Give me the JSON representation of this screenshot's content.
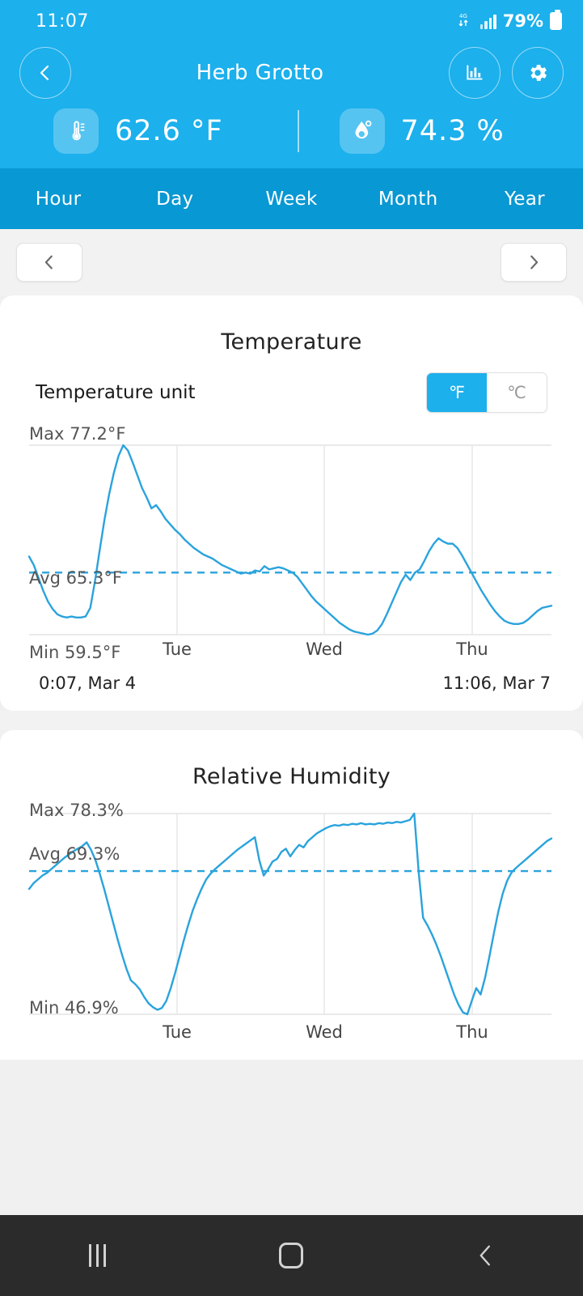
{
  "status_bar": {
    "time": "11:07",
    "network_icon": "4g-data-transfer-icon",
    "signal_icon": "signal-bars-icon",
    "battery_percent": "79%",
    "battery_icon": "battery-icon"
  },
  "header": {
    "back_icon": "chevron-left-icon",
    "title": "Herb Grotto",
    "chart_icon": "bar-chart-icon",
    "settings_icon": "gear-icon",
    "temperature": {
      "icon": "thermometer-icon",
      "value": "62.6 °F"
    },
    "humidity": {
      "icon": "water-drop-icon",
      "value": "74.3 %"
    }
  },
  "tabs": {
    "items": [
      {
        "label": "Hour"
      },
      {
        "label": "Day"
      },
      {
        "label": "Week"
      },
      {
        "label": "Month"
      },
      {
        "label": "Year"
      }
    ],
    "selected": "Day"
  },
  "pager": {
    "prev_icon": "chevron-left-icon",
    "next_icon": "chevron-right-icon"
  },
  "temperature_card": {
    "title": "Temperature",
    "unit_label": "Temperature unit",
    "unit_options": [
      {
        "label": "℉",
        "selected": true
      },
      {
        "label": "℃",
        "selected": false
      }
    ],
    "max_label": "Max 77.2°F",
    "avg_label": "Avg 65.3°F",
    "min_label": "Min 59.5°F",
    "start_label": "0:07, Mar 4",
    "end_label": "11:06, Mar 7",
    "x_ticks": [
      "Tue",
      "Wed",
      "Thu"
    ]
  },
  "humidity_card": {
    "title": "Relative Humidity",
    "max_label": "Max 78.3%",
    "avg_label": "Avg 69.3%",
    "min_label": "Min 46.9%",
    "x_ticks": [
      "Tue",
      "Wed",
      "Thu"
    ]
  },
  "nav_bar": {
    "recents_icon": "recent-apps-icon",
    "home_icon": "home-icon",
    "back_icon": "back-chevron-icon"
  },
  "colors": {
    "brand": "#1cb0ec",
    "tab_bar": "#0898d3",
    "line": "#2aa3dd",
    "page_bg": "#f2f2f2",
    "nav_bg": "#2b2b2b"
  },
  "chart_data": [
    {
      "type": "line",
      "title": "Temperature",
      "ylabel": "°F",
      "xlabel": "",
      "grid": true,
      "legend": "none",
      "max": 77.2,
      "min": 59.5,
      "avg": 65.3,
      "ylim": [
        59.5,
        77.2
      ],
      "x_tick_labels": [
        "Tue",
        "Wed",
        "Thu"
      ],
      "x_range": [
        "0:07, Mar 4",
        "11:06, Mar 7"
      ],
      "avg_reference_line": 65.3,
      "values": [
        66.8,
        66.0,
        64.8,
        63.6,
        62.6,
        61.9,
        61.4,
        61.2,
        61.1,
        61.2,
        61.1,
        61.1,
        61.2,
        62.0,
        64.5,
        67.4,
        70.2,
        72.6,
        74.6,
        76.2,
        77.2,
        76.7,
        75.6,
        74.4,
        73.2,
        72.3,
        71.3,
        71.6,
        71.0,
        70.3,
        69.8,
        69.3,
        68.9,
        68.4,
        68.0,
        67.6,
        67.3,
        67.0,
        66.8,
        66.6,
        66.3,
        66.0,
        65.8,
        65.6,
        65.4,
        65.2,
        65.3,
        65.2,
        65.5,
        65.4,
        65.9,
        65.6,
        65.7,
        65.8,
        65.7,
        65.5,
        65.3,
        64.9,
        64.3,
        63.7,
        63.1,
        62.6,
        62.2,
        61.8,
        61.4,
        61.0,
        60.6,
        60.3,
        60.0,
        59.8,
        59.7,
        59.6,
        59.5,
        59.6,
        59.9,
        60.5,
        61.4,
        62.4,
        63.4,
        64.4,
        65.1,
        64.6,
        65.3,
        65.6,
        66.4,
        67.3,
        68.0,
        68.5,
        68.2,
        68.0,
        68.0,
        67.6,
        66.9,
        66.1,
        65.3,
        64.5,
        63.7,
        63.0,
        62.3,
        61.7,
        61.2,
        60.8,
        60.6,
        60.5,
        60.5,
        60.6,
        60.9,
        61.3,
        61.7,
        62.0,
        62.1,
        62.2
      ]
    },
    {
      "type": "line",
      "title": "Relative Humidity",
      "ylabel": "%",
      "xlabel": "",
      "grid": true,
      "legend": "none",
      "max": 78.3,
      "min": 46.9,
      "avg": 69.3,
      "ylim": [
        46.9,
        78.3
      ],
      "x_tick_labels": [
        "Tue",
        "Wed",
        "Thu"
      ],
      "avg_reference_line": 69.3,
      "values": [
        66.5,
        67.4,
        68.0,
        68.6,
        69.0,
        69.6,
        70.2,
        70.8,
        71.4,
        71.9,
        72.4,
        72.8,
        73.2,
        73.8,
        72.6,
        71.0,
        68.8,
        66.4,
        63.8,
        61.2,
        58.6,
        56.2,
        54.0,
        52.2,
        51.6,
        50.8,
        49.6,
        48.6,
        48.0,
        47.6,
        47.9,
        49.0,
        51.0,
        53.4,
        56.0,
        58.6,
        61.0,
        63.2,
        65.0,
        66.6,
        68.0,
        68.9,
        69.6,
        70.2,
        70.8,
        71.4,
        72.0,
        72.6,
        73.1,
        73.6,
        74.1,
        74.6,
        71.0,
        68.6,
        69.6,
        70.8,
        71.2,
        72.3,
        72.8,
        71.6,
        72.6,
        73.4,
        73.0,
        74.0,
        74.6,
        75.2,
        75.6,
        76.0,
        76.3,
        76.5,
        76.4,
        76.6,
        76.5,
        76.7,
        76.6,
        76.8,
        76.6,
        76.7,
        76.6,
        76.8,
        76.7,
        76.9,
        76.8,
        77.0,
        76.9,
        77.1,
        77.3,
        78.3,
        69.2,
        62.0,
        60.8,
        59.4,
        57.8,
        56.0,
        54.0,
        52.0,
        50.0,
        48.4,
        47.2,
        46.9,
        49.0,
        51.0,
        50.0,
        52.6,
        56.0,
        59.6,
        63.0,
        65.8,
        67.8,
        69.1,
        69.8,
        70.4,
        71.0,
        71.6,
        72.2,
        72.8,
        73.4,
        74.0,
        74.4
      ]
    }
  ]
}
